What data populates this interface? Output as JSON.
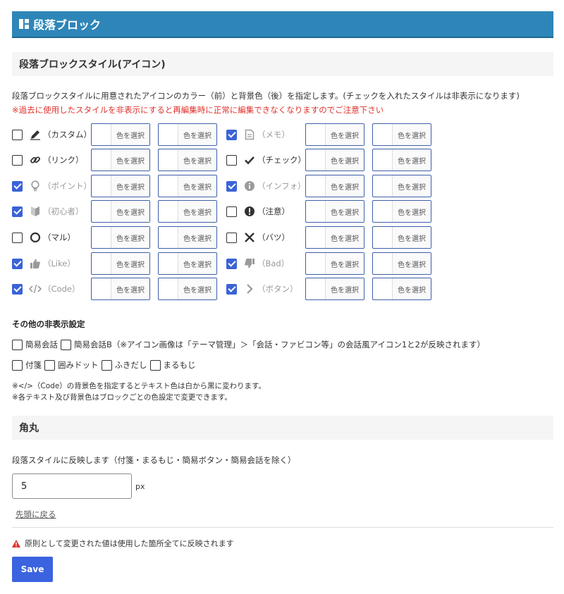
{
  "header": {
    "title": "段落ブロック"
  },
  "section1": {
    "title": "段落ブロックスタイル(アイコン)",
    "desc": "段落ブロックスタイルに用意されたアイコンのカラー（前）と背景色（後）を指定します。(チェックを入れたスタイルは非表示になります)",
    "warning": "※過去に使用したスタイルを非表示にすると再編集時に正常に編集できなくなりますのでご注意下さい"
  },
  "picker_label": "色を選択",
  "styles": [
    {
      "label": "（カスタム）",
      "icon": "pencil-icon",
      "checked": false
    },
    {
      "label": "（メモ）",
      "icon": "memo-icon",
      "checked": true
    },
    {
      "label": "（リンク）",
      "icon": "link-icon",
      "checked": false
    },
    {
      "label": "（チェック）",
      "icon": "check-icon",
      "checked": false
    },
    {
      "label": "（ポイント）",
      "icon": "lightbulb-icon",
      "checked": true
    },
    {
      "label": "（インフォ）",
      "icon": "info-icon",
      "checked": true
    },
    {
      "label": "（初心者）",
      "icon": "beginner-icon",
      "checked": true
    },
    {
      "label": "（注意）",
      "icon": "exclamation-icon",
      "checked": false
    },
    {
      "label": "（マル）",
      "icon": "circle-icon",
      "checked": false
    },
    {
      "label": "（バツ）",
      "icon": "cross-icon",
      "checked": false
    },
    {
      "label": "（Like）",
      "icon": "thumbs-up-icon",
      "checked": true
    },
    {
      "label": "（Bad）",
      "icon": "thumbs-down-icon",
      "checked": true
    },
    {
      "label": "（Code）",
      "icon": "code-icon",
      "checked": true
    },
    {
      "label": "（ボタン）",
      "icon": "chevron-right-icon",
      "checked": true
    }
  ],
  "other": {
    "title": "その他の非表示設定",
    "line1": [
      {
        "label": "簡易会話"
      },
      {
        "label": "簡易会話B（※アイコン画像は「テーマ管理」＞「会話・ファビコン等」の会話風アイコン1と2が反映されます）"
      }
    ],
    "line2": [
      {
        "label": "付箋"
      },
      {
        "label": "囲みドット"
      },
      {
        "label": "ふきだし"
      },
      {
        "label": "まるもじ"
      }
    ],
    "note1": "※</>（Code）の背景色を指定するとテキスト色は白から黒に変わります。",
    "note2": "※各テキスト及び背景色はブロックごとの色設定で変更できます。"
  },
  "section2": {
    "title": "角丸",
    "desc": "段落スタイルに反映します（付箋・まるもじ・簡易ボタン・簡易会話を除く）",
    "value": "5",
    "unit": "px"
  },
  "back_link": "先頭に戻る",
  "notice": "原則として変更された値は使用した箇所全てに反映されます",
  "save_label": "Save",
  "colors": {
    "header": "#2e86b8",
    "checkbox": "#3b63d6",
    "warning": "#e0312b",
    "save": "#3b63e0"
  }
}
